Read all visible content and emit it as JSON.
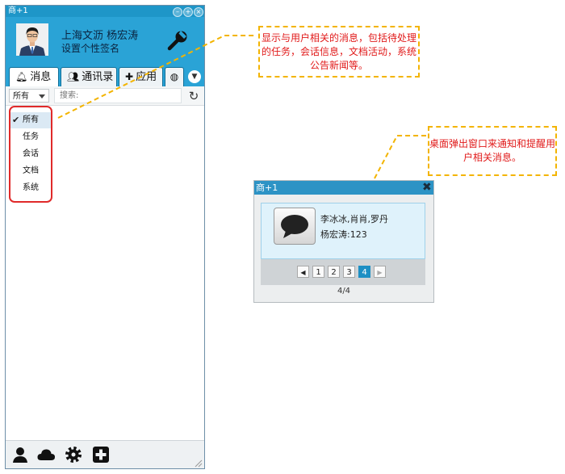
{
  "app": {
    "title": "商+1",
    "window_controls": [
      "minimize",
      "maximize",
      "close"
    ]
  },
  "profile": {
    "name": "上海文沥 杨宏涛",
    "signature": "设置个性签名",
    "settings_icon": "wrench-icon"
  },
  "tabs": [
    {
      "label": "消息",
      "icon": "bell-icon",
      "active": true
    },
    {
      "label": "通讯录",
      "icon": "contacts-icon",
      "active": false
    },
    {
      "label": "应用",
      "icon": "puzzle-icon",
      "active": false
    },
    {
      "label": "",
      "icon": "globe-icon",
      "active": false
    }
  ],
  "filter": {
    "selected": "所有",
    "search_placeholder": "搜索:",
    "options": [
      "所有",
      "任务",
      "会话",
      "文档",
      "系统"
    ]
  },
  "bottom_toolbar": [
    "user-icon",
    "cloud-icon",
    "gear-icon",
    "plus-square-icon"
  ],
  "notes": {
    "note1": "显示与用户相关的消息，包括待处理的任务，会话信息，文档活动，系统公告新闻等。",
    "note2": "桌面弹出窗口来通知和提醒用户相关消息。"
  },
  "popup": {
    "title": "商+1",
    "senders": "李冰冰,肖肖,罗丹",
    "message": "杨宏涛:123",
    "pages": [
      "1",
      "2",
      "3",
      "4"
    ],
    "current_page": "4",
    "page_count": "4/4"
  },
  "colors": {
    "accent": "#2aa3d6",
    "note_border": "#f3b400",
    "note_text": "#e11b1b",
    "dropdown_highlight": "#e02a2a"
  }
}
